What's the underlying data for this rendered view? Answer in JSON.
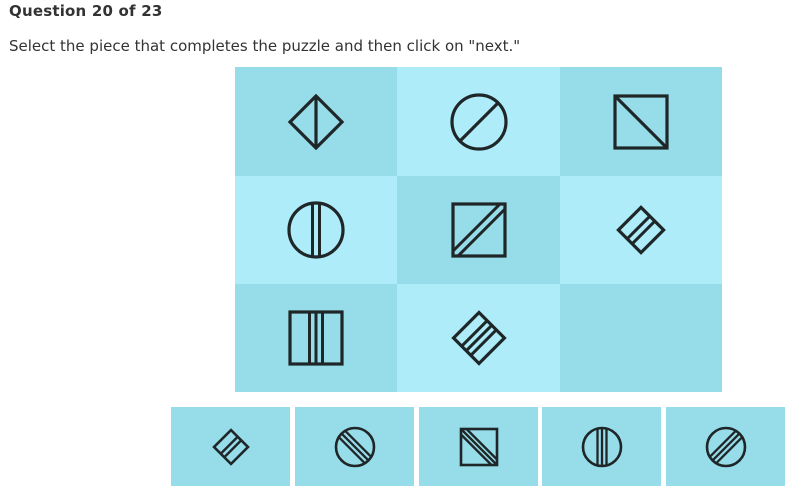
{
  "header": {
    "question_label": "Question 20 of 23",
    "instructions": "Select the piece that completes the puzzle and then click on \"next.\""
  },
  "colors": {
    "cell_dark": "#97dce9",
    "cell_light": "#aeecf9",
    "option_bg": "#97dce9",
    "stroke": "#1f2628"
  },
  "puzzle": {
    "cells": [
      {
        "shade": "dark",
        "shape": "diamond-split-vertical-icon"
      },
      {
        "shade": "light",
        "shape": "circle-single-slash-icon"
      },
      {
        "shade": "dark",
        "shape": "square-single-diagonal-icon"
      },
      {
        "shade": "light",
        "shape": "circle-double-vertical-icon"
      },
      {
        "shade": "dark",
        "shape": "square-double-diagonal-icon"
      },
      {
        "shade": "light",
        "shape": "diamond-double-lines-icon"
      },
      {
        "shade": "dark",
        "shape": "square-triple-vertical-icon"
      },
      {
        "shade": "light",
        "shape": "diamond-triple-lines-icon"
      },
      {
        "shade": "dark",
        "shape": "empty-answer-slot"
      }
    ]
  },
  "options": [
    {
      "shape": "diamond-double-lines-icon"
    },
    {
      "shape": "circle-triple-backslash-icon"
    },
    {
      "shape": "square-triple-diagonal-icon"
    },
    {
      "shape": "circle-triple-vertical-icon"
    },
    {
      "shape": "circle-triple-slash-icon"
    }
  ]
}
